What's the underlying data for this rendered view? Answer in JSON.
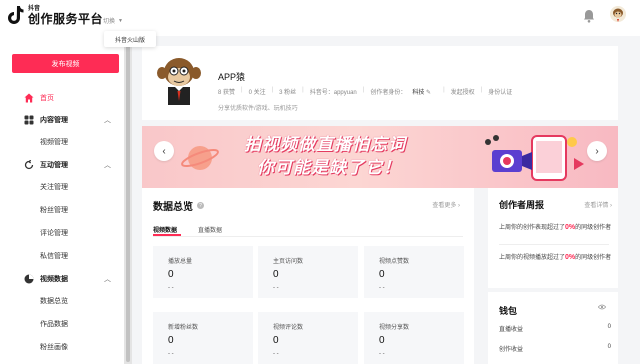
{
  "header": {
    "logo_small": "抖音",
    "logo_title": "创作服务平台",
    "switch_label": "切换",
    "dropdown_option": "抖音火山版"
  },
  "sidebar": {
    "publish_label": "发布视频",
    "items": [
      {
        "label": "首页",
        "type": "section",
        "icon": "home-icon",
        "active": true
      },
      {
        "label": "内容管理",
        "type": "section",
        "icon": "grid-icon",
        "expanded": true
      },
      {
        "label": "视频管理",
        "type": "sub"
      },
      {
        "label": "互动管理",
        "type": "section",
        "icon": "refresh-icon",
        "expanded": true
      },
      {
        "label": "关注管理",
        "type": "sub"
      },
      {
        "label": "粉丝管理",
        "type": "sub"
      },
      {
        "label": "评论管理",
        "type": "sub"
      },
      {
        "label": "私信管理",
        "type": "sub"
      },
      {
        "label": "视频数据",
        "type": "section",
        "icon": "pie-chart-icon",
        "expanded": true
      },
      {
        "label": "数据总览",
        "type": "sub"
      },
      {
        "label": "作品数据",
        "type": "sub"
      },
      {
        "label": "粉丝画像",
        "type": "sub"
      }
    ]
  },
  "profile": {
    "name": "APP猿",
    "likes": "8 获赞",
    "following": "0 关注",
    "fans": "3 粉丝",
    "douyin_id": "抖音号：appyuan",
    "identity_label": "创作者身份：",
    "identity_value": "科技",
    "authorize": "发起授权",
    "certify": "身份认证",
    "bio": "分享优质软件/游戏、玩机技巧"
  },
  "banner": {
    "line1": "拍视频做直播怕忘词",
    "line2": "你可能是缺了它！"
  },
  "overview": {
    "title": "数据总览",
    "more": "查看更多",
    "tabs": [
      "视频数据",
      "直播数据"
    ],
    "metrics": [
      {
        "label": "播放总量",
        "value": "0",
        "delta": "- -"
      },
      {
        "label": "主页访问数",
        "value": "0",
        "delta": "- -"
      },
      {
        "label": "视频点赞数",
        "value": "0",
        "delta": "- -"
      },
      {
        "label": "新增粉丝数",
        "value": "0",
        "delta": "- -"
      },
      {
        "label": "视频评论数",
        "value": "0",
        "delta": "- -"
      },
      {
        "label": "视频分享数",
        "value": "0",
        "delta": "- -"
      }
    ]
  },
  "weekly": {
    "title": "创作者周报",
    "more": "查看详情",
    "line1_prefix": "上周你的创作表现超过了",
    "line1_pct": "0%",
    "line1_suffix": "的同级创作者",
    "line2_prefix": "上周你的视频播放超过了",
    "line2_pct": "0%",
    "line2_suffix": "的同级创作者"
  },
  "wallet": {
    "title": "钱包",
    "rows": [
      {
        "label": "直播收益",
        "value": "0"
      },
      {
        "label": "创作收益",
        "value": "0"
      }
    ]
  },
  "colors": {
    "accent": "#fe2c55",
    "page_bg": "#f4f5f7"
  }
}
